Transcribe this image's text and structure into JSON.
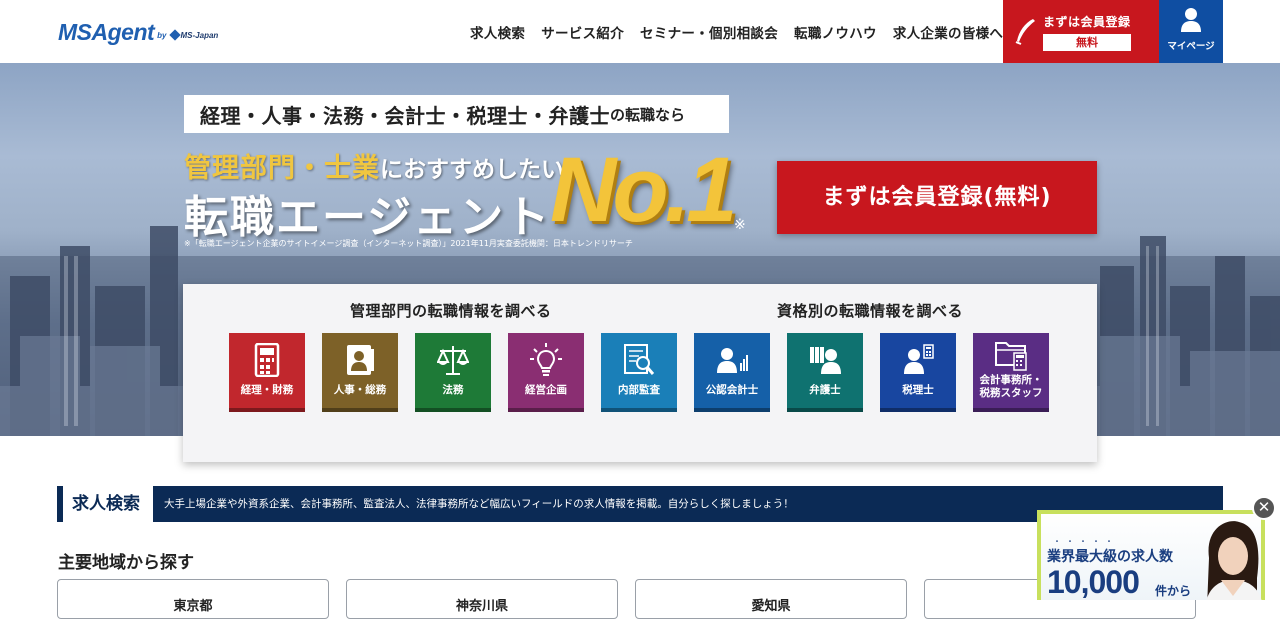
{
  "header": {
    "logo": {
      "main": "MSAgent",
      "by": "by",
      "company": "MS-Japan"
    },
    "nav": [
      "求人検索",
      "サービス紹介",
      "セミナー・個別相談会",
      "転職ノウハウ",
      "求人企業の皆様へ"
    ],
    "register": {
      "label": "まずは会員登録",
      "free": "無料",
      "icon": "pen-icon"
    },
    "mypage": {
      "label": "マイページ",
      "icon": "person-icon"
    }
  },
  "hero": {
    "tagline_main": "経理・人事・法務・会計士・税理士・弁護士",
    "tagline_suffix": "の転職なら",
    "line1_gold": "管理部門・士業",
    "line1_white": "におすすめしたい",
    "line2": "転職エージェント",
    "badge": "No.1",
    "note_mark": "※",
    "footnote": "※「転職エージェント企業のサイトイメージ調査（インターネット調査）」2021年11月実査委託機関：日本トレンドリサーチ",
    "cta": "まずは会員登録(無料)"
  },
  "search_panel": {
    "dept_heading": "管理部門の転職情報を調べる",
    "license_heading": "資格別の転職情報を調べる",
    "tiles": [
      {
        "label": "経理・財務",
        "icon": "calculator-icon",
        "color": "#c1272d"
      },
      {
        "label": "人事・総務",
        "icon": "id-card-icon",
        "color": "#7d6128"
      },
      {
        "label": "法務",
        "icon": "scales-icon",
        "color": "#1e7a37"
      },
      {
        "label": "経営企画",
        "icon": "lightbulb-icon",
        "color": "#8a2e72"
      },
      {
        "label": "内部監査",
        "icon": "audit-document-icon",
        "color": "#1a7fb8"
      },
      {
        "label": "公認会計士",
        "icon": "accountant-icon",
        "color": "#1560a8"
      },
      {
        "label": "弁護士",
        "icon": "lawyer-icon",
        "color": "#0f7270"
      },
      {
        "label": "税理士",
        "icon": "tax-accountant-icon",
        "color": "#1846a0"
      },
      {
        "label": "会計事務所・",
        "label2": "税務スタッフ",
        "icon": "folder-calculator-icon",
        "color": "#5a2d84"
      }
    ]
  },
  "job_search": {
    "heading": "求人検索",
    "description": "大手上場企業や外資系企業、会計事務所、監査法人、法律事務所など幅広いフィールドの求人情報を掲載。自分らしく探しましょう！",
    "region_heading": "主要地域から探す",
    "regions": [
      "東京都",
      "神奈川県",
      "愛知県",
      ""
    ]
  },
  "ad": {
    "dots": "・・・・・",
    "line1": "業界最大級の求人数",
    "number": "10,000",
    "suffix": "件から",
    "close": "✕"
  }
}
